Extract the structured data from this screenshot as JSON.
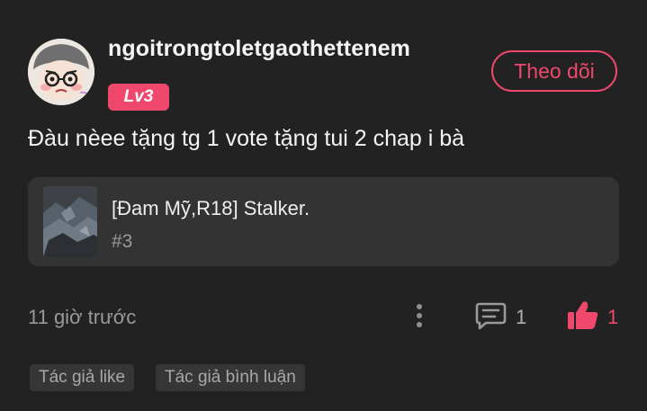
{
  "post": {
    "username": "ngoitrongtoletgaothettenem",
    "level": "Lv3",
    "follow_label": "Theo dõi",
    "comment_text": "Đàu nèee tặng tg 1 vote tặng tui 2 chap i bà",
    "story": {
      "title": "[Đam Mỹ,R18] Stalker.",
      "chapter": "#3"
    },
    "timestamp": "11 giờ trước",
    "reply_count": "1",
    "like_count": "1",
    "tags": [
      "Tác giả like",
      "Tác giả bình luận"
    ]
  },
  "icons": {
    "more": "more-vertical-icon",
    "comment": "comment-icon",
    "like": "thumbs-up-icon"
  },
  "colors": {
    "background": "#222222",
    "card": "#333333",
    "accent": "#f0476d",
    "muted_text": "#9a9a9a"
  }
}
